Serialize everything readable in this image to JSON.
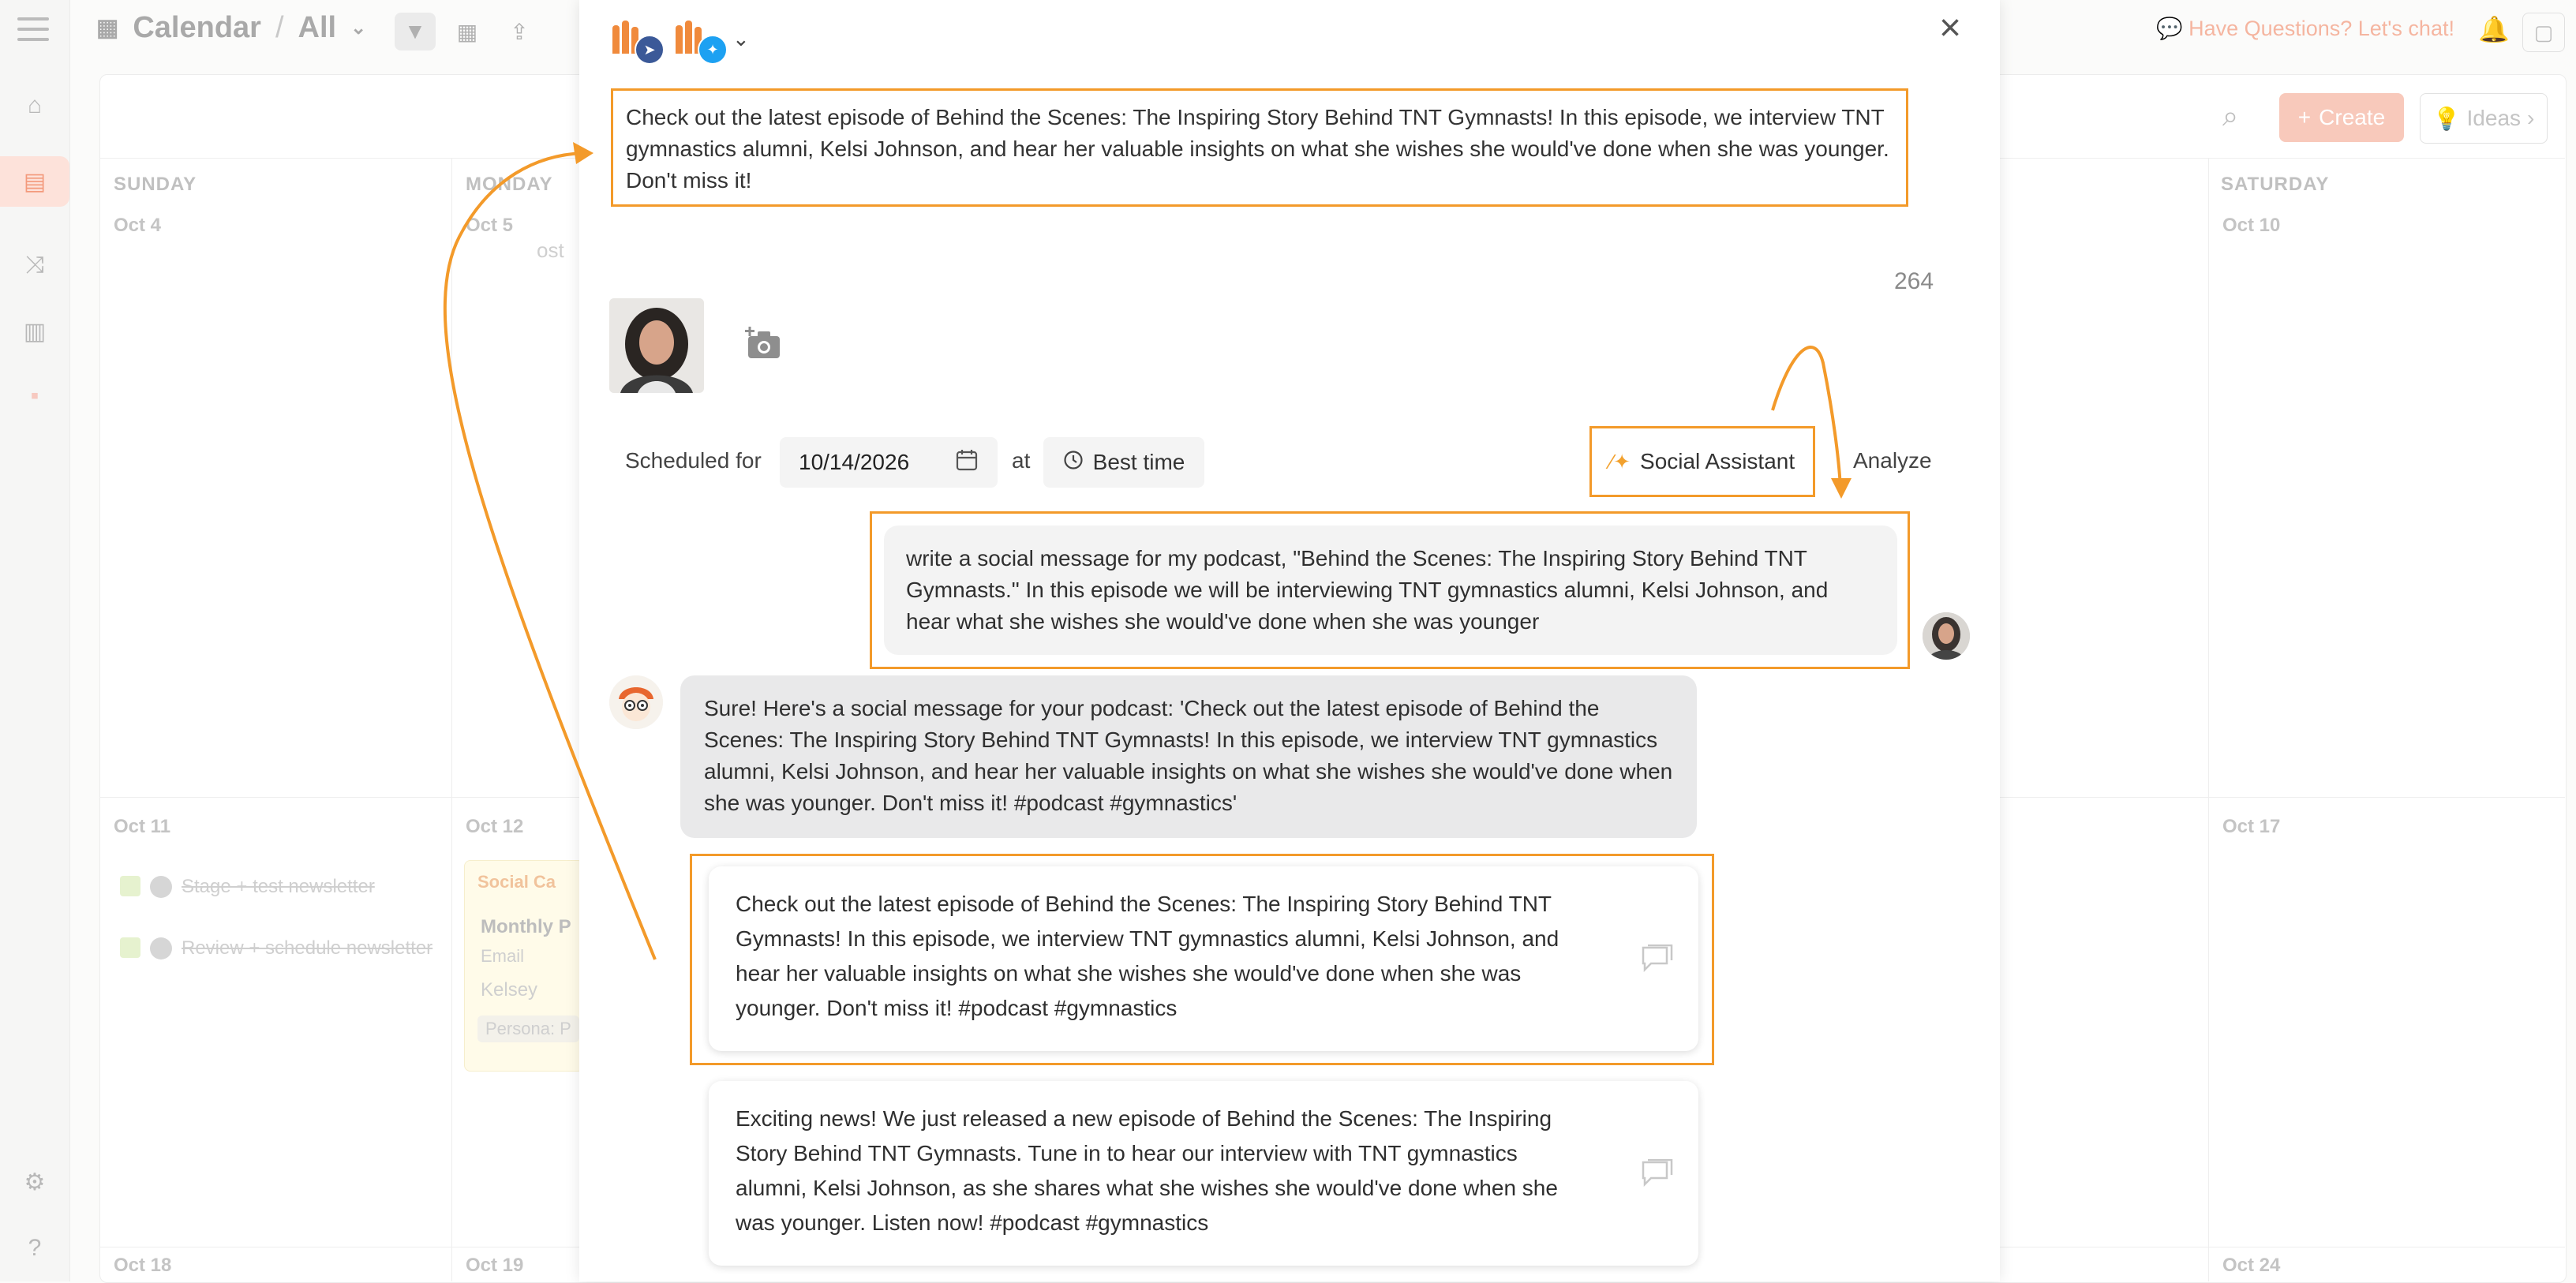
{
  "header": {
    "title": "Calendar",
    "separator": "/",
    "view": "All",
    "help_text": "Have Questions? Let's chat!"
  },
  "toolbar": {
    "create_label": "Create",
    "ideas_label": "Ideas"
  },
  "calendar": {
    "days": [
      "SUNDAY",
      "MONDAY",
      "SATURDAY"
    ],
    "dates_row1": [
      "Oct 4",
      "Oct 5",
      "Oct 10"
    ],
    "dates_row2": [
      "Oct 11",
      "Oct 12",
      "Oct 17"
    ],
    "dates_row3": [
      "Oct 18",
      "Oct 19",
      "Oct 24"
    ],
    "fragment": "ost",
    "tasks": [
      {
        "label": "Stage + test newsletter"
      },
      {
        "label": "Review + schedule newsletter"
      }
    ],
    "social_card": {
      "header": "Social Ca",
      "title": "Monthly P",
      "type": "Email",
      "owner": "Kelsey",
      "persona": "Persona: P"
    }
  },
  "modal": {
    "message_text": "Check out the latest episode of Behind the Scenes: The Inspiring Story Behind TNT Gymnasts! In this episode, we interview TNT gymnastics alumni, Kelsi Johnson, and hear her valuable insights on what she wishes she would've done when she was younger. Don't miss it!",
    "char_count": "264",
    "scheduled_label": "Scheduled for",
    "date_value": "10/14/2026",
    "at_label": "at",
    "best_time_label": "Best time",
    "social_assistant_label": "Social Assistant",
    "analyze_label": "Analyze",
    "user_prompt": "write a social message for my podcast, \"Behind the Scenes: The Inspiring Story Behind TNT Gymnasts.\" In this episode we will be interviewing TNT gymnastics alumni, Kelsi Johnson, and hear what she wishes she would've done when she was younger",
    "assistant_reply": "Sure! Here's a social message for your podcast: 'Check out the latest episode of Behind the Scenes: The Inspiring Story Behind TNT Gymnasts! In this episode, we interview TNT gymnastics alumni, Kelsi Johnson, and hear her valuable insights on what she wishes she would've done when she was younger. Don't miss it! #podcast #gymnastics'",
    "suggestions": [
      "Check out the latest episode of Behind the Scenes: The Inspiring Story Behind TNT Gymnasts! In this episode, we interview TNT gymnastics alumni, Kelsi Johnson, and hear her valuable insights on what she wishes she would've done when she was younger. Don't miss it! #podcast #gymnastics",
      "Exciting news! We just released a new episode of Behind the Scenes: The Inspiring Story Behind TNT Gymnasts. Tune in to hear our interview with TNT gymnastics alumni, Kelsi Johnson, as she shares what she wishes she would've done when she was younger. Listen now! #podcast #gymnastics"
    ]
  },
  "colors": {
    "accent": "#f39a2a",
    "brand": "#f08a3c",
    "facebook": "#3b5998",
    "twitter": "#1da1f2"
  },
  "icons": [
    "menu-icon",
    "calendar-icon",
    "chevron-down-icon",
    "filter-icon",
    "close-icon",
    "camera-add-icon",
    "clock-icon",
    "wand-icon",
    "comment-icon",
    "bell-icon",
    "search-icon"
  ]
}
